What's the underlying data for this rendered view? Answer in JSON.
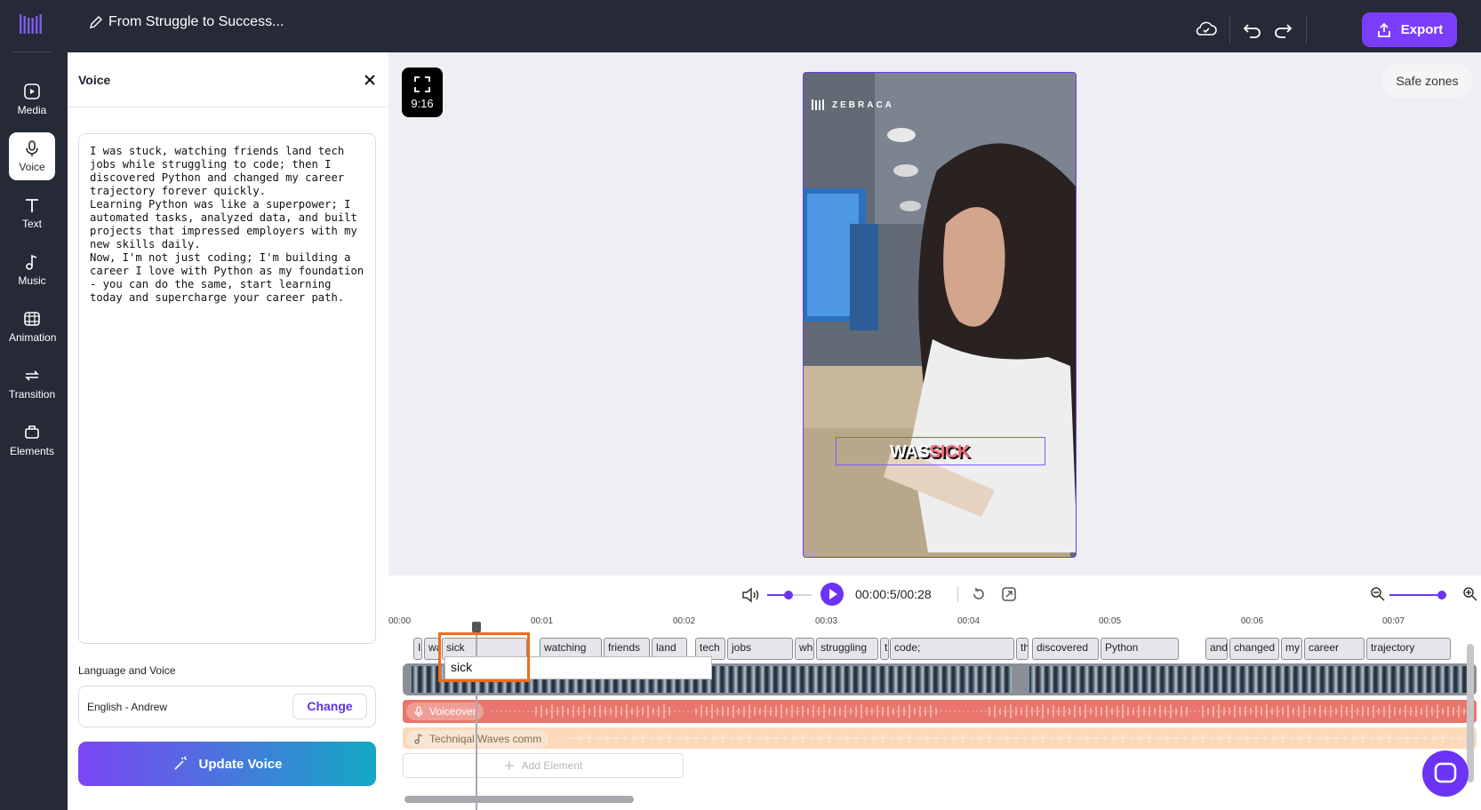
{
  "header": {
    "project_title": "From Struggle to Success...",
    "export_label": "Export"
  },
  "sidebar": {
    "items": [
      {
        "label": "Media",
        "icon": "media-icon"
      },
      {
        "label": "Voice",
        "icon": "microphone-icon",
        "active": true
      },
      {
        "label": "Text",
        "icon": "text-icon"
      },
      {
        "label": "Music",
        "icon": "music-note-icon"
      },
      {
        "label": "Animation",
        "icon": "film-icon"
      },
      {
        "label": "Transition",
        "icon": "swap-icon"
      },
      {
        "label": "Elements",
        "icon": "shapes-icon"
      }
    ]
  },
  "panel": {
    "title": "Voice",
    "script": "I was stuck, watching friends land tech\njobs while struggling to code; then I\ndiscovered Python and changed my career\ntrajectory forever quickly.\nLearning Python was like a superpower; I\nautomated tasks, analyzed data, and built\nprojects that impressed employers with my\nnew skills daily.\nNow, I'm not just coding; I'm building a\ncareer I love with Python as my foundation\n- you can do the same, start learning\ntoday and supercharge your career path.",
    "language_label": "Language and Voice",
    "language_value": "English - Andrew",
    "change_label": "Change",
    "update_label": "Update Voice"
  },
  "canvas": {
    "ratio_label": "9:16",
    "safe_zones_label": "Safe zones",
    "brand_text": "ZEBRACA",
    "caption_part1": "WAS",
    "caption_part2": "SICK"
  },
  "timeline": {
    "time_display": "00:00:5/00:28",
    "ruler": [
      "00:00",
      "00:01",
      "00:02",
      "00:03",
      "00:04",
      "00:05",
      "00:06",
      "00:07"
    ],
    "words": [
      "I",
      "wa",
      "sick",
      "watching",
      "friends",
      "land",
      "tech",
      "jobs",
      "wh",
      "struggling",
      "t",
      "code;",
      "th",
      "discovered",
      "Python",
      "and",
      "changed",
      "my",
      "career",
      "trajectory"
    ],
    "edit_value": "sick",
    "voice_track_label": "Voiceover",
    "music_track_label": "Techniqal Waves comm",
    "add_element_label": "Add Element"
  },
  "colors": {
    "accent": "#7b3dfc",
    "topbar": "#262a36",
    "voice_track": "#e8766c",
    "music_track": "#fbd9b9",
    "highlight": "#f26a1d"
  }
}
